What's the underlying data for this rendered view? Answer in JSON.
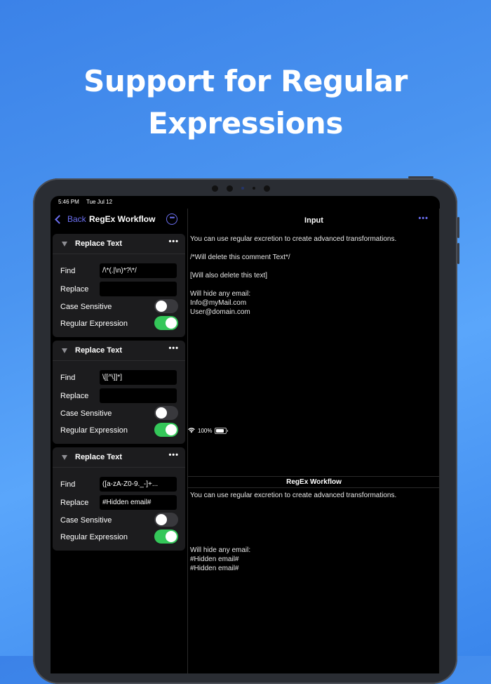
{
  "headline": {
    "line1": "Support for Regular",
    "line2": "Expressions"
  },
  "status_bar": {
    "time": "5:46 PM",
    "date": "Tue Jul 12",
    "battery": "100%"
  },
  "nav": {
    "back_label": "Back",
    "title": "RegEx Workflow",
    "more_icon": "ellipsis-circle-icon"
  },
  "steps": [
    {
      "title": "Replace Text",
      "find_label": "Find",
      "find_value": "/\\*(.|\\n)*?\\*/",
      "replace_label": "Replace",
      "replace_value": "",
      "case_label": "Case Sensitive",
      "case_on": false,
      "regex_label": "Regular Expression",
      "regex_on": true
    },
    {
      "title": "Replace Text",
      "find_label": "Find",
      "find_value": "\\[[^\\]]*]",
      "replace_label": "Replace",
      "replace_value": "",
      "case_label": "Case Sensitive",
      "case_on": false,
      "regex_label": "Regular Expression",
      "regex_on": true
    },
    {
      "title": "Replace Text",
      "find_label": "Find",
      "find_value": "([a-zA-Z0-9._-]+...",
      "replace_label": "Replace",
      "replace_value": "#Hidden email#",
      "case_label": "Case Sensitive",
      "case_on": false,
      "regex_label": "Regular Expression",
      "regex_on": true
    }
  ],
  "input_panel": {
    "title": "Input",
    "lines": [
      "You can use regular excretion to create advanced transformations.",
      "",
      "/*Will delete this comment Text*/",
      "",
      "[Will also delete this text]",
      "",
      "Will hide any email:",
      "Info@myMail.com",
      "User@domain.com"
    ]
  },
  "output_panel": {
    "title": "RegEx Workflow",
    "lines": [
      "You can use regular excretion to create advanced transformations.",
      "",
      "",
      "",
      "",
      "",
      "Will hide any email:",
      "#Hidden email#",
      "#Hidden email#"
    ]
  },
  "colors": {
    "accent": "#6b6ff0",
    "toggle_on": "#34c759",
    "background_top": "#3b82e8"
  }
}
